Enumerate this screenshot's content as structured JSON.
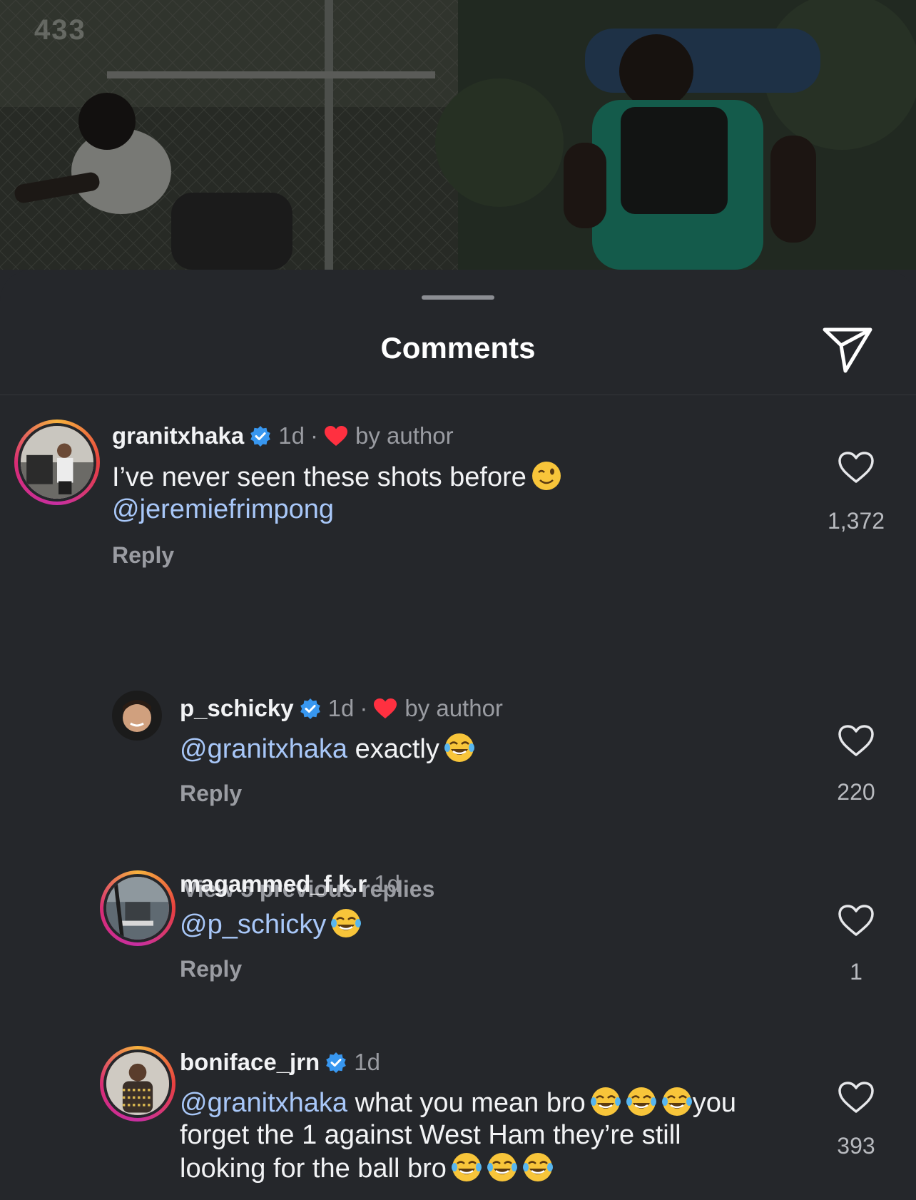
{
  "media": {
    "watermark": "433"
  },
  "sheet": {
    "title": "Comments"
  },
  "comments": [
    {
      "username": "granitxhaka",
      "verified": true,
      "time": "1d",
      "separator": "·",
      "liked_by_author": "by author",
      "text": "I’ve never seen these shots before",
      "mention": "@jeremiefrimpong",
      "reply": "Reply",
      "likes": "1,372"
    },
    {
      "username": "p_schicky",
      "verified": true,
      "time": "1d",
      "separator": "·",
      "liked_by_author": "by author",
      "mention": "@granitxhaka",
      "text": "exactly",
      "reply": "Reply",
      "likes": "220"
    },
    {
      "username": "magammed_f.k.r",
      "verified": false,
      "time": "1d",
      "mention": "@p_schicky",
      "reply": "Reply",
      "likes": "1"
    },
    {
      "username": "boniface_jrn",
      "verified": true,
      "time": "1d",
      "mention": "@granitxhaka",
      "text_part1": "what you mean bro",
      "text_part2": "you",
      "text_line2": "forget the 1 against West Ham they’re still",
      "text_line3": "looking for the ball bro",
      "likes": "393"
    }
  ],
  "view_previous": "View 5 previous replies",
  "colors": {
    "background": "#25272b",
    "mention": "#a8c7f8",
    "verified": "#3897f0",
    "heart": "#ff3040"
  },
  "icons": [
    "share-icon",
    "verified-icon",
    "heart-icon",
    "heart-outline-icon",
    "wink-emoji",
    "laughing-emoji"
  ]
}
